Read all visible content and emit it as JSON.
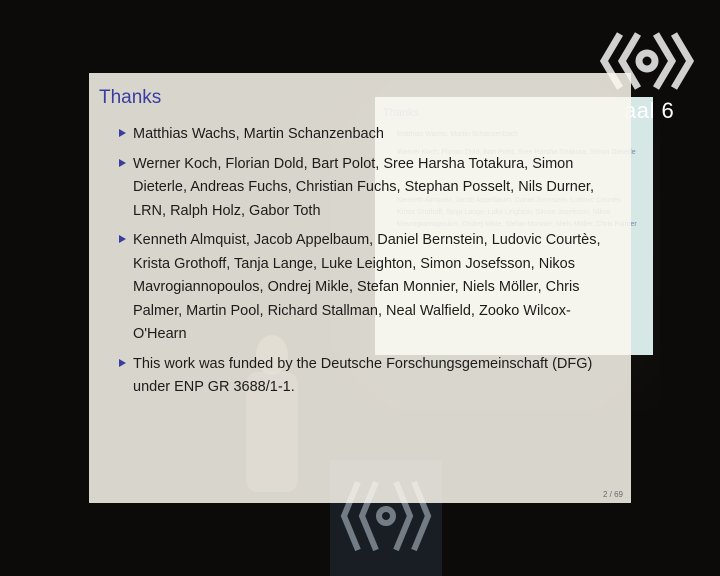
{
  "slide": {
    "title": "Thanks",
    "bullets": [
      "Matthias Wachs, Martin Schanzenbach",
      "Werner Koch, Florian Dold, Bart Polot, Sree Harsha Totakura, Simon Dieterle, Andreas Fuchs, Christian Fuchs, Stephan Posselt, Nils Durner, LRN, Ralph Holz, Gabor Toth",
      "Kenneth Almquist, Jacob Appelbaum, Daniel Bernstein, Ludovic Courtès, Krista Grothoff, Tanja Lange, Luke Leighton, Simon Josefsson, Nikos Mavrogiannopoulos, Ondrej Mikle, Stefan Monnier, Niels Möller, Chris Palmer, Martin Pool, Richard Stallman, Neal Walfield, Zooko Wilcox-O'Hearn",
      "This work was funded by the Deutsche Forschungsgemeinschaft (DFG) under ENP GR 3688/1-1."
    ],
    "page_number": "2 / 69",
    "accent_color": "#3a3da0"
  },
  "overlay": {
    "channel_label": "aal 6",
    "logo_icon": "conference-logo-icon"
  }
}
